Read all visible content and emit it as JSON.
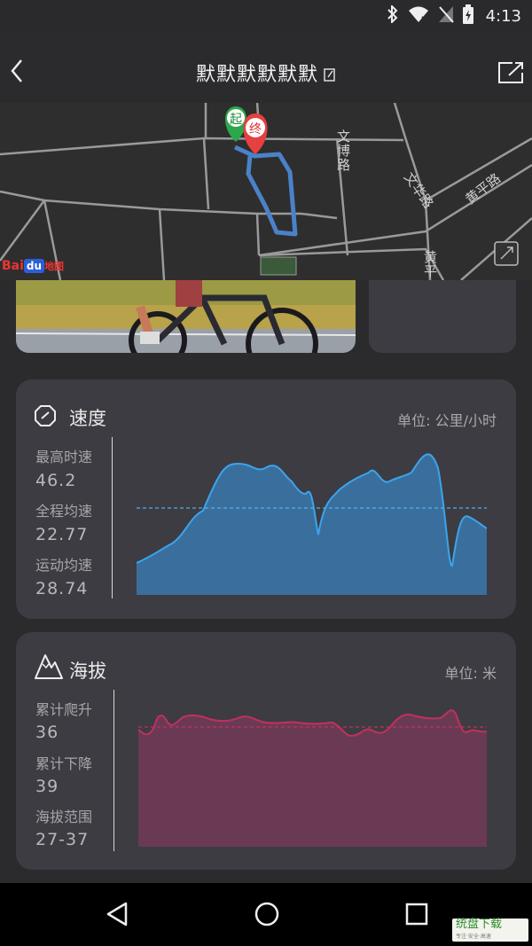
{
  "status_bar": {
    "time": "4:13"
  },
  "header": {
    "title": "默默默默默默"
  },
  "map": {
    "road_labels": [
      "文博路",
      "文华路",
      "黄平路",
      "黄平"
    ],
    "start_marker": "起",
    "end_marker": "终",
    "logo_text": "Bai",
    "logo_du": "du",
    "logo_map": "地图"
  },
  "speed_card": {
    "title": "速度",
    "unit": "单位: 公里/小时",
    "stats": [
      {
        "label": "最高时速",
        "value": "46.2"
      },
      {
        "label": "全程均速",
        "value": "22.77"
      },
      {
        "label": "运动均速",
        "value": "28.74"
      }
    ],
    "color": "#2f8fd8"
  },
  "altitude_card": {
    "title": "海拔",
    "unit": "单位: 米",
    "stats": [
      {
        "label": "累计爬升",
        "value": "36"
      },
      {
        "label": "累计下降",
        "value": "39"
      },
      {
        "label": "海拔范围",
        "value": "27-37"
      }
    ],
    "color": "#c2305e"
  },
  "watermark": {
    "text": "统盘下载",
    "sub": "专注·安全·高速"
  }
}
